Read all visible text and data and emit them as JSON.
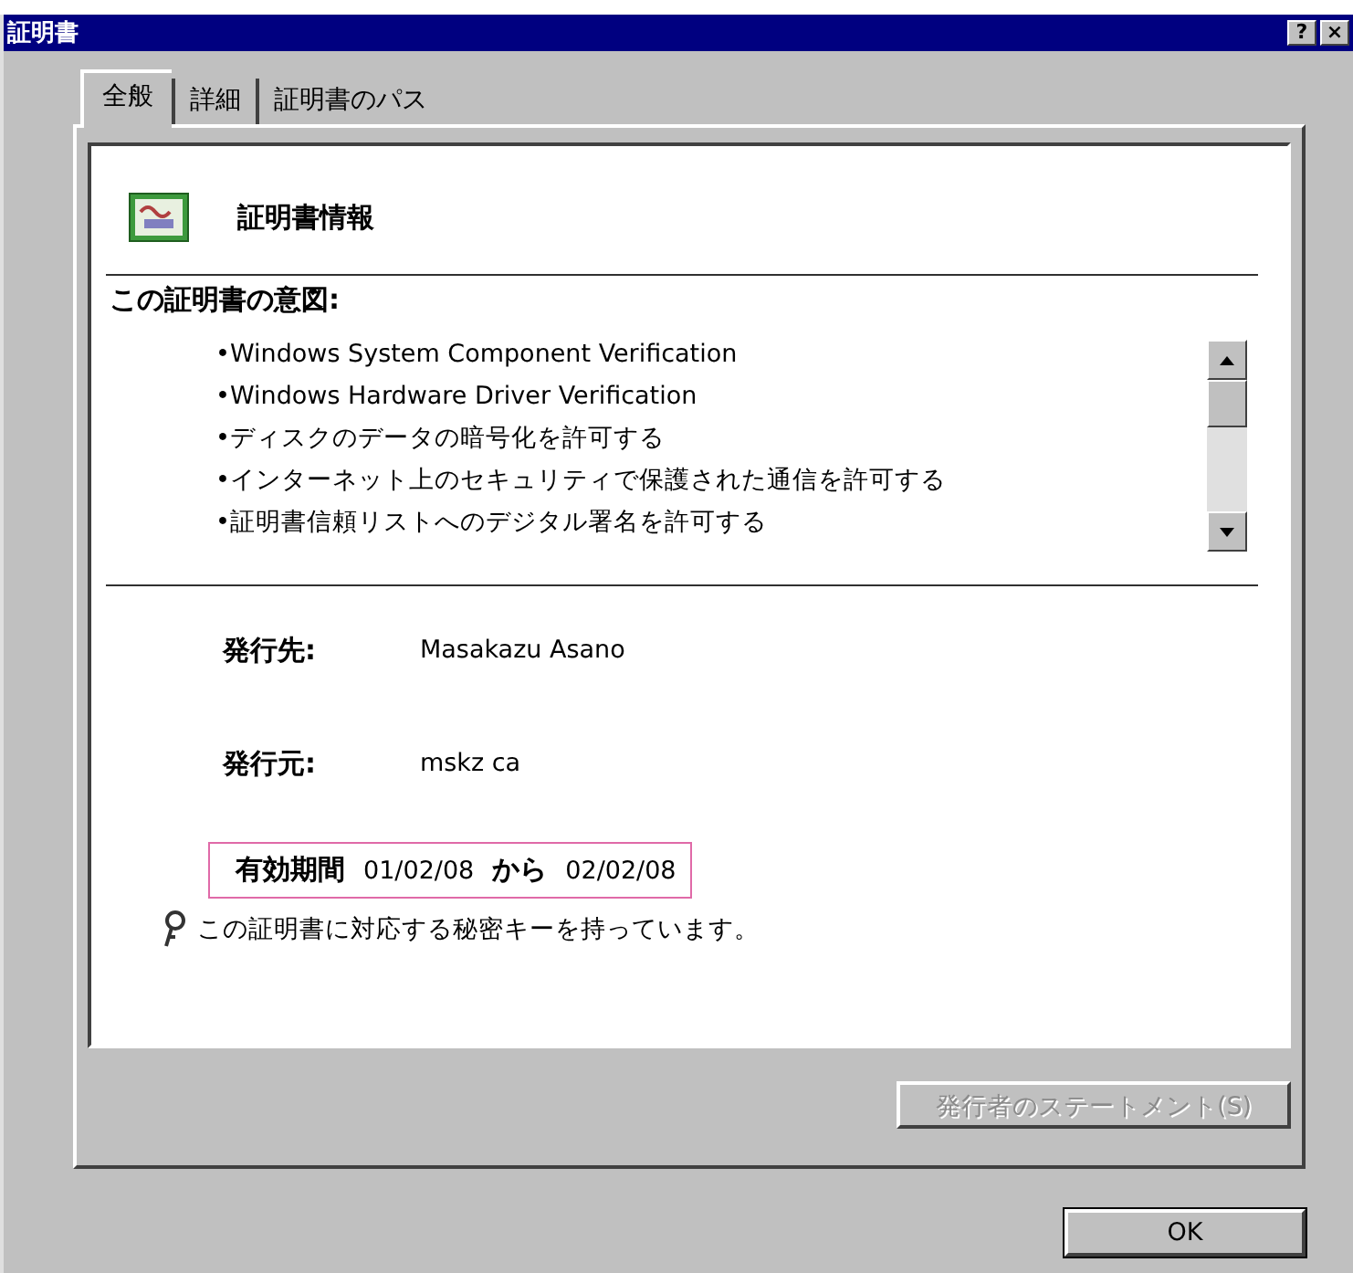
{
  "window": {
    "title": "証明書",
    "help_button": "?",
    "close_button": "×"
  },
  "tabs": [
    {
      "label": "全般",
      "selected": true
    },
    {
      "label": "詳細",
      "selected": false
    },
    {
      "label": "証明書のパス",
      "selected": false
    }
  ],
  "certificate": {
    "heading": "証明書情報",
    "purpose_label": "この証明書の意図:",
    "purposes": [
      "•Windows System Component Verification",
      "•Windows Hardware Driver Verification",
      "•ディスクのデータの暗号化を許可する",
      "•インターネット上のセキュリティで保護された通信を許可する",
      "•証明書信頼リストへのデジタル署名を許可する"
    ],
    "fields": [
      {
        "label": "発行先:",
        "value": "Masakazu Asano"
      },
      {
        "label": "発行元:",
        "value": "mskz ca"
      }
    ],
    "validity": {
      "label": "有効期間",
      "from": "01/02/08",
      "to_word": "から",
      "to": "02/02/08"
    },
    "key_note": "この証明書に対応する秘密キーを持っています。"
  },
  "issuer_statement_button": {
    "label": "発行者のステートメント(S)",
    "disabled": true
  },
  "ok_button": {
    "label": "OK"
  }
}
